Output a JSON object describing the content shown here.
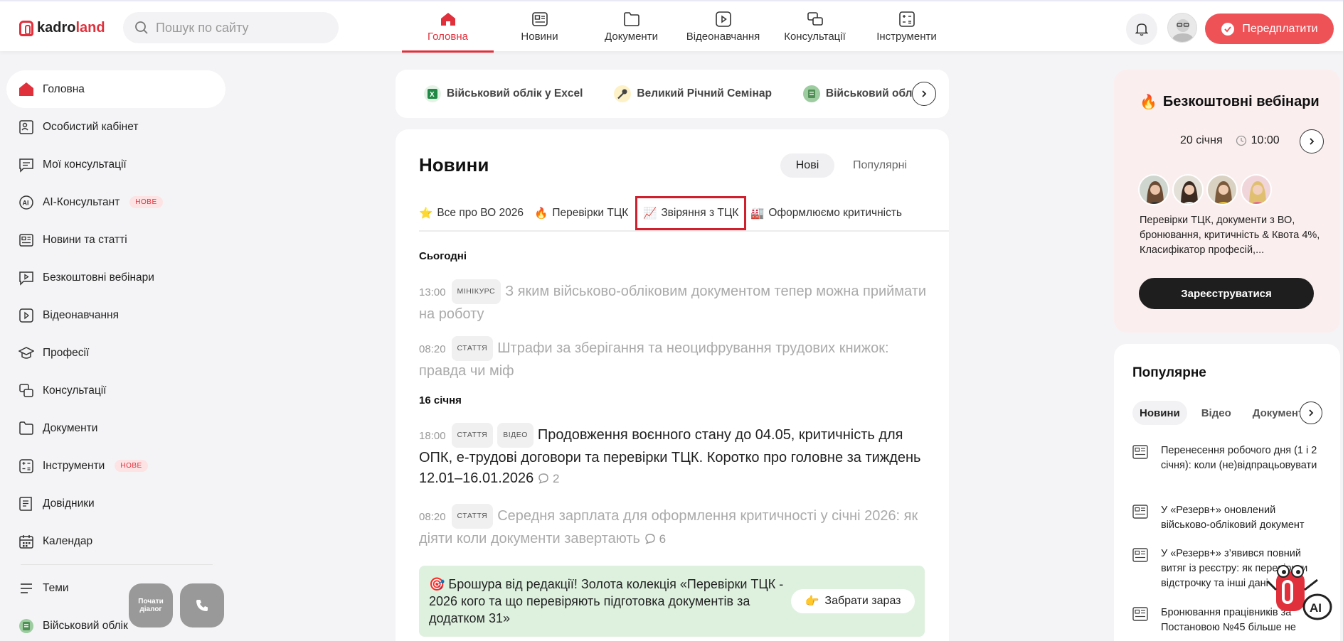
{
  "header": {
    "logo_kadro": "kadro",
    "logo_land": "land",
    "search_placeholder": "Пошук по сайту",
    "nav": [
      {
        "label": "Головна",
        "icon": "home-icon",
        "active": true
      },
      {
        "label": "Новини",
        "icon": "newspaper-icon"
      },
      {
        "label": "Документи",
        "icon": "folder-icon"
      },
      {
        "label": "Відеонавчання",
        "icon": "video-icon"
      },
      {
        "label": "Консультації",
        "icon": "chat-icon"
      },
      {
        "label": "Інструменти",
        "icon": "tools-icon"
      }
    ],
    "subscribe_label": "Передплатити"
  },
  "sidebar": {
    "items": [
      {
        "label": "Головна",
        "icon": "home-icon",
        "active": true
      },
      {
        "label": "Особистий кабінет",
        "icon": "user-card-icon"
      },
      {
        "label": "Мої консультації",
        "icon": "message-icon"
      },
      {
        "label": "AI-Консультант",
        "icon": "ai-icon",
        "badge": "НОВЕ"
      },
      {
        "label": "Новини та статті",
        "icon": "newspaper-icon"
      },
      {
        "label": "Безкоштовні вебінари",
        "icon": "webinar-icon"
      },
      {
        "label": "Відеонавчання",
        "icon": "video-icon"
      },
      {
        "label": "Професії",
        "icon": "graduation-cap-icon"
      },
      {
        "label": "Консультації",
        "icon": "chat-icon"
      },
      {
        "label": "Документи",
        "icon": "folder-icon"
      },
      {
        "label": "Інструменти",
        "icon": "tools-icon",
        "badge": "НОВЕ"
      },
      {
        "label": "Довідники",
        "icon": "book-icon"
      },
      {
        "label": "Календар",
        "icon": "calendar-icon"
      }
    ],
    "bottom_items": [
      {
        "label": "Теми",
        "icon": "menu-icon"
      },
      {
        "label": "Військовий облік",
        "icon": "military-icon"
      }
    ],
    "chat_bubble_label": "Почати діалог"
  },
  "quick_links": [
    {
      "label": "Військовий облік у Excel",
      "icon": "excel-icon"
    },
    {
      "label": "Великий Річний Семінар",
      "icon": "microphone-icon"
    },
    {
      "label": "Військовий облік",
      "icon": "military-icon"
    }
  ],
  "news": {
    "title": "Новини",
    "toggle_new": "Нові",
    "toggle_popular": "Популярні",
    "filters": [
      {
        "emoji": "⭐",
        "label": "Все про ВО 2026"
      },
      {
        "emoji": "🔥",
        "label": "Перевірки ТЦК"
      },
      {
        "emoji": "📈",
        "label": "Звіряння з ТЦК"
      },
      {
        "emoji": "🏭",
        "label": "Оформлюємо критичність"
      }
    ],
    "day_today": "Сьогодні",
    "day_16": "16 січня",
    "articles": [
      {
        "time": "13:00",
        "tags": [
          "МІНІКУРС"
        ],
        "title": "З яким військово-обліковим документом тепер можна приймати на роботу"
      },
      {
        "time": "08:20",
        "tags": [
          "СТАТТЯ"
        ],
        "title": "Штрафи за зберігання та неоцифрування трудових книжок: правда чи міф"
      },
      {
        "time": "18:00",
        "tags": [
          "СТАТТЯ",
          "ВІДЕО"
        ],
        "title": "Продовження воєнного стану до 04.05, критичність для ОПК, е-трудові договори та перевірки ТЦК. Коротко про головне за тиждень 12.01–16.01.2026",
        "comments": "2"
      },
      {
        "time": "08:20",
        "tags": [
          "СТАТТЯ"
        ],
        "title": "Середня зарплата для оформлення критичності у січні 2026: як діяти коли документи завертають",
        "comments": "6"
      }
    ],
    "promo_text": "Брошура від редакції! Золота колекція «Перевірки ТЦК - 2026 кого та що перевіряють підготовка документів за додатком 31»",
    "promo_button": "Забрати зараз"
  },
  "webinar": {
    "title": "Безкоштовні вебінари",
    "date": "20 січня",
    "time": "10:00",
    "description": "Перевірки ТЦК, документи з ВО, бронювання, критичність & Квота 4%, Класифікатор професій,...",
    "register_label": "Зареєструватися"
  },
  "popular": {
    "title": "Популярне",
    "tabs": [
      "Новини",
      "Відео",
      "Документи"
    ],
    "items": [
      "Перенесення робочого дня (1 і 2 січня): коли (не)відпрацьовувати",
      "У «Резерв+» оновлений військово-обліковий документ",
      "У «Резерв+» з’явився повний витяг із реєстру: як перевірити відстрочку та інші дані",
      "Бронювання працівників за Постановою №45 більше не"
    ]
  },
  "colors": {
    "accent": "#e0303c",
    "subscribe": "#ee5257",
    "promo_bg": "#def1df",
    "webinar_bg": "#fbeeee"
  }
}
